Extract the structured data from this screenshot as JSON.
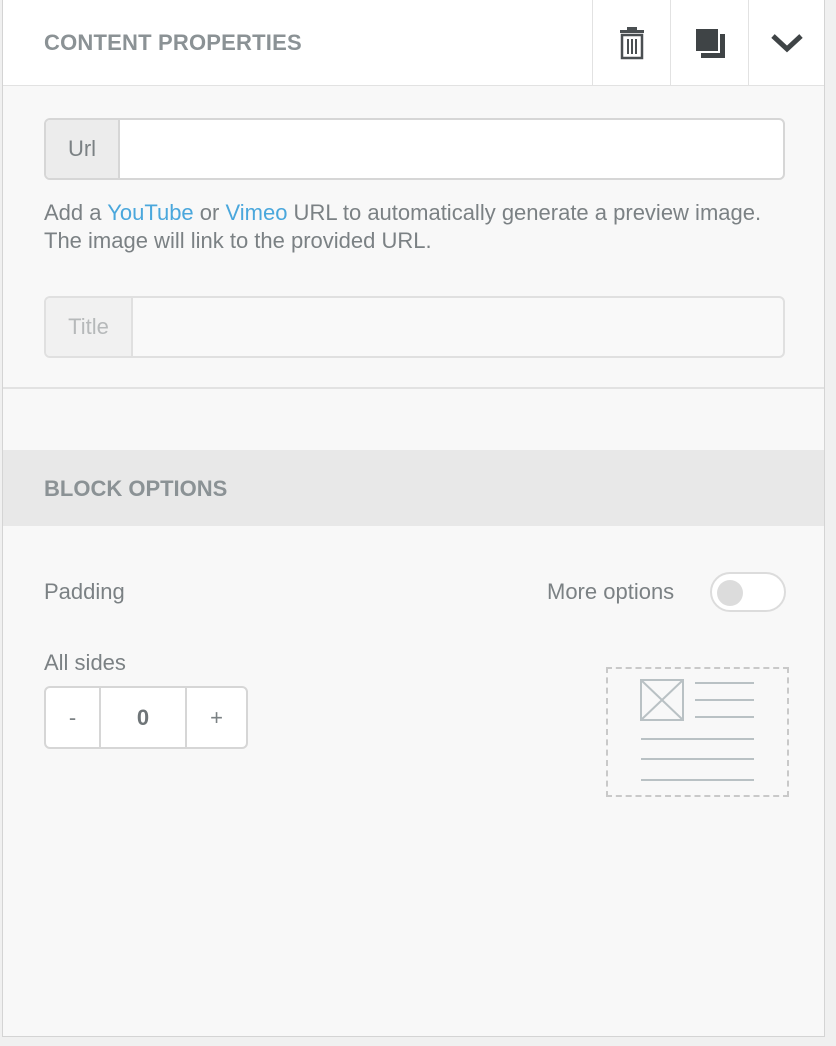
{
  "content_properties": {
    "title": "CONTENT PROPERTIES",
    "icons": {
      "delete": "trash-icon",
      "duplicate": "duplicate-icon",
      "collapse": "chevron-down-icon"
    }
  },
  "url_field": {
    "addon_label": "Url",
    "value": "",
    "placeholder": ""
  },
  "help_text": {
    "prefix": "Add a ",
    "youtube_link": "YouTube",
    "middle": " or ",
    "vimeo_link": "Vimeo",
    "suffix": " URL to automatically generate a preview image. The image will link to the provided URL."
  },
  "title_field": {
    "addon_label": "Title",
    "value": "",
    "placeholder": ""
  },
  "block_options": {
    "title": "BLOCK OPTIONS",
    "padding_label": "Padding",
    "more_options_label": "More options",
    "more_options_enabled": false,
    "all_sides_label": "All sides",
    "stepper": {
      "minus_label": "-",
      "value": "0",
      "plus_label": "+"
    },
    "preview_icon": "padding-preview-icon"
  },
  "colors": {
    "link": "#4aa7dc",
    "label": "#7b8184",
    "header_bg": "#e8e8e8"
  }
}
